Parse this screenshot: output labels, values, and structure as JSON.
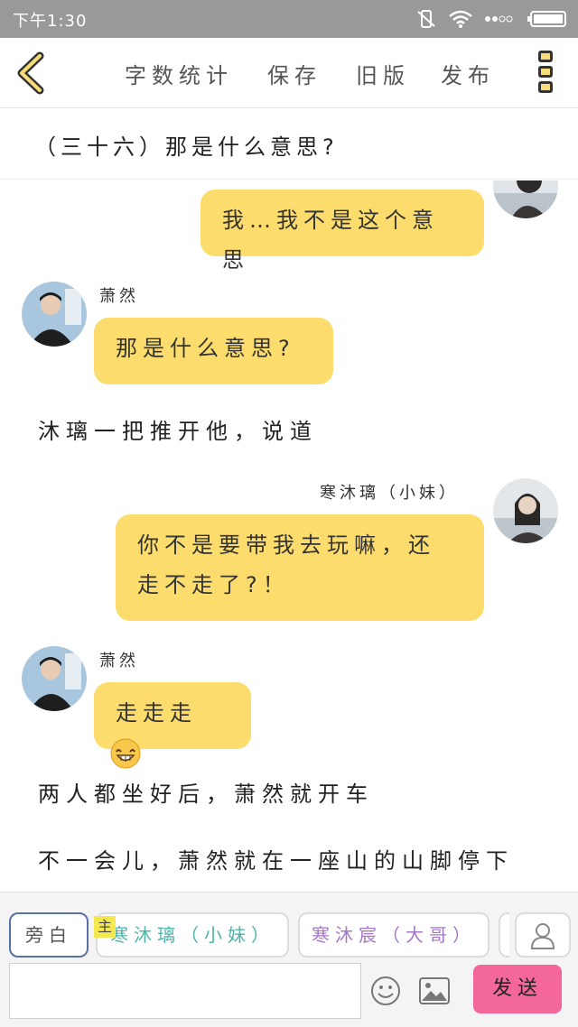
{
  "status": {
    "time": "下午1:30"
  },
  "topbar": {
    "word_count": "字数统计",
    "save": "保存",
    "old_version": "旧版",
    "publish": "发布"
  },
  "chapter": {
    "title": "（三十六）那是什么意思?"
  },
  "messages": [
    {
      "type": "bubble-right",
      "text": "我…我不是这个意思"
    },
    {
      "type": "bubble-left",
      "name": "萧然",
      "text": "那是什么意思?"
    },
    {
      "type": "narration",
      "text": "沐璃一把推开他，说道"
    },
    {
      "type": "bubble-right",
      "name": "寒沐璃（小妹）",
      "line1": "你不是要带我去玩嘛，还",
      "line2": "走不走了?！"
    },
    {
      "type": "bubble-left",
      "name": "萧然",
      "text": "走走走"
    },
    {
      "type": "narration",
      "text": "两人都坐好后，萧然就开车"
    },
    {
      "type": "narration",
      "text": "不一会儿，萧然就在一座山的山脚停下"
    }
  ],
  "bottom": {
    "narrator": "旁白",
    "main_badge": "主",
    "char1": "寒沐璃（小妹）",
    "char2": "寒沐宸（大哥）",
    "send": "发送"
  },
  "colors": {
    "bubble": "#fcdc6c",
    "send": "#f3679a",
    "char1": "#4fb3a9",
    "char2": "#a676c8",
    "accent": "#f6dd79"
  },
  "icons": [
    "back-chevron-icon",
    "more-menu-icon",
    "emoji-icon",
    "image-icon",
    "person-icon",
    "wifi-icon",
    "battery-icon"
  ]
}
